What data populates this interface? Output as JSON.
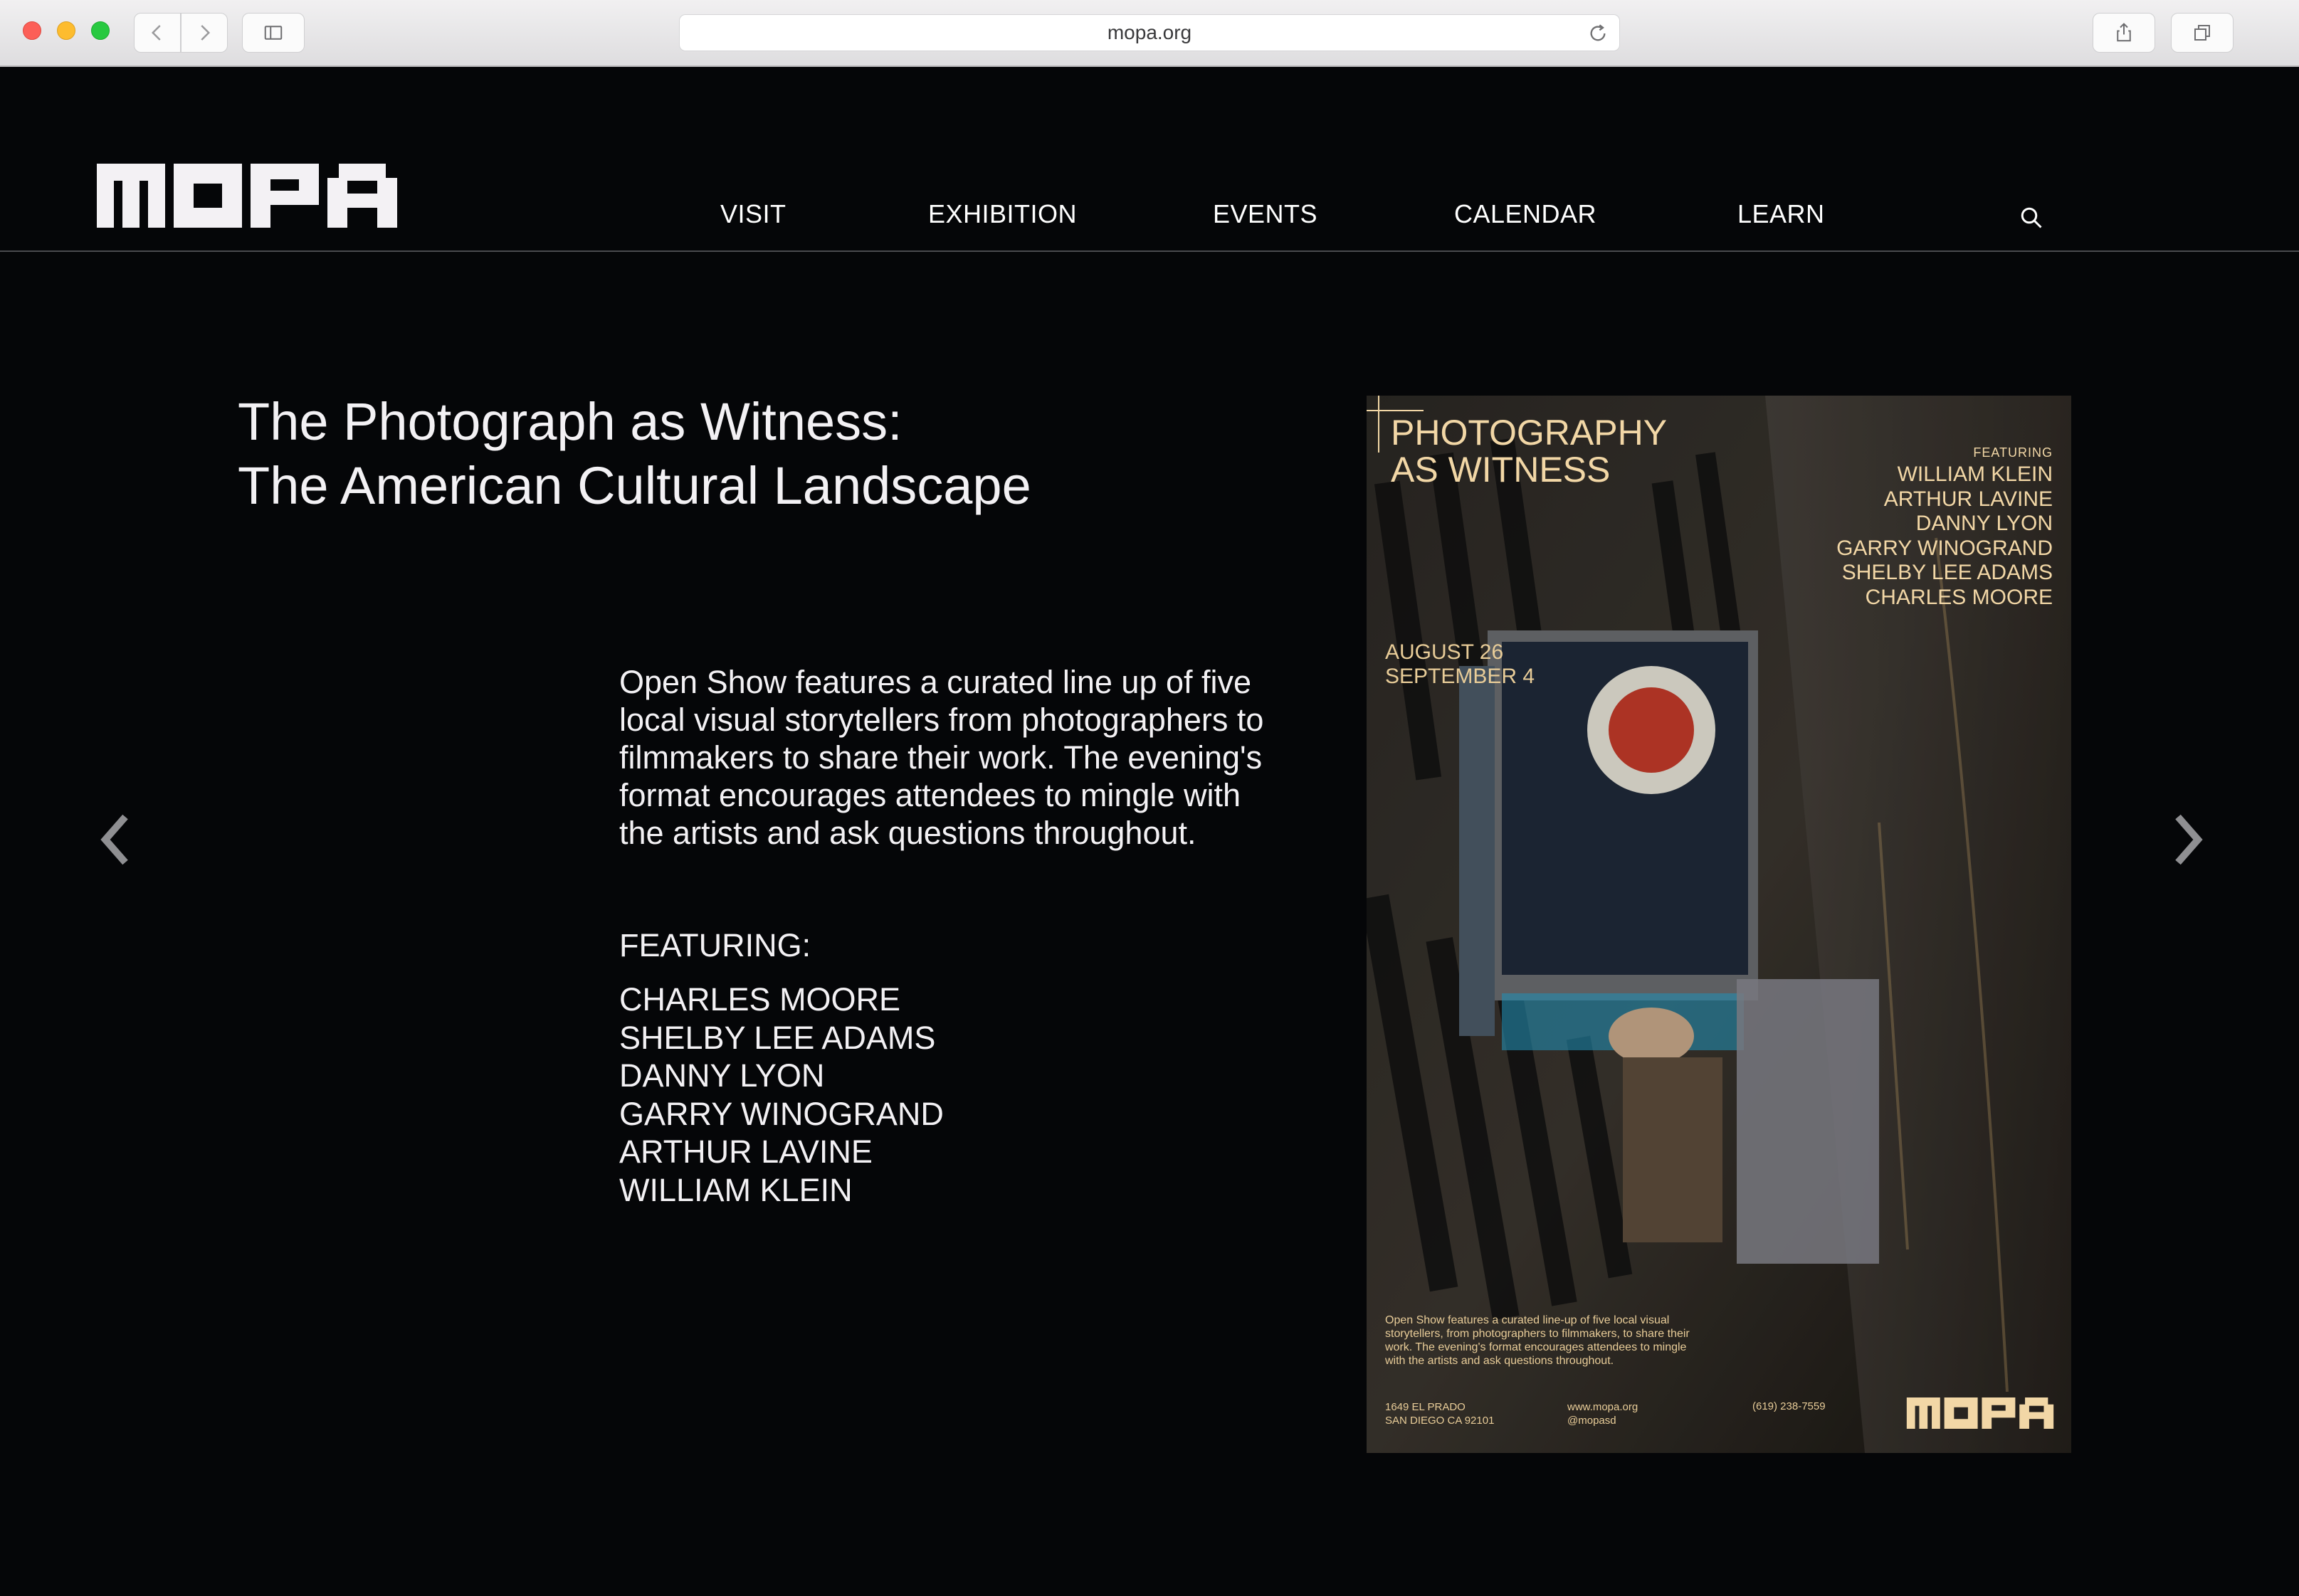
{
  "browser": {
    "url": "mopa.org",
    "icons": [
      "back-icon",
      "forward-icon",
      "sidebar-icon",
      "reload-icon",
      "share-icon",
      "tabs-icon"
    ]
  },
  "site": {
    "logo_alt": "MOPA",
    "nav": [
      {
        "label": "VISIT"
      },
      {
        "label": "EXHIBITION"
      },
      {
        "label": "EVENTS"
      },
      {
        "label": "CALENDAR"
      },
      {
        "label": "LEARN"
      }
    ]
  },
  "exhibition": {
    "title_line1": "The Photograph as Witness:",
    "title_line2": "The American Cultural Landscape",
    "description": "Open Show features a curated line up of five local visual storytellers from photographers to filmmakers to share their work. The evening's format encourages attendees to mingle with the artists and ask questions throughout.",
    "featuring_label": "FEATURING:",
    "artists": [
      "CHARLES MOORE",
      "SHELBY LEE ADAMS",
      "DANNY LYON",
      "GARRY WINOGRAND",
      "ARTHUR LAVINE",
      "WILLIAM KLEIN"
    ]
  },
  "poster": {
    "title_line1": "PHOTOGRAPHY",
    "title_line2": "AS WITNESS",
    "featuring_label": "FEATURING",
    "artists": [
      "WILLIAM KLEIN",
      "ARTHUR LAVINE",
      "DANNY LYON",
      "GARRY WINOGRAND",
      "SHELBY LEE ADAMS",
      "CHARLES MOORE"
    ],
    "date_start": "AUGUST 26",
    "date_end": "SEPTEMBER 4",
    "description": "Open Show features a curated line-up of five local visual storytellers, from photographers to filmmakers, to share their work. The evening's format encourages attendees to mingle with the artists and ask questions throughout.",
    "address_line1": "1649 EL PRADO",
    "address_line2": "SAN DIEGO CA 92101",
    "website": "www.mopa.org",
    "handle": "@mopasd",
    "phone": "(619) 238-7559"
  },
  "colors": {
    "background": "#050608",
    "text": "#f3f1f4",
    "poster_accent": "#f2d7a6",
    "rule": "#4a4b4f"
  }
}
